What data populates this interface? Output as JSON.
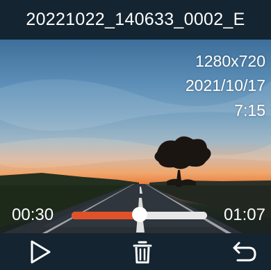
{
  "title": "20221022_140633_0002_E",
  "video_info": {
    "resolution": "1280x720",
    "date": "2021/10/17",
    "time": "7:15"
  },
  "playback": {
    "current_time": "00:30",
    "total_time": "01:07",
    "progress_percent": 50
  },
  "colors": {
    "bar_background": "#142430",
    "progress_fill": "#e2522a",
    "progress_track": "#e7e7e7",
    "text": "#ffffff"
  },
  "toolbar": {
    "icons": [
      "play-icon",
      "trash-icon",
      "back-icon"
    ]
  }
}
